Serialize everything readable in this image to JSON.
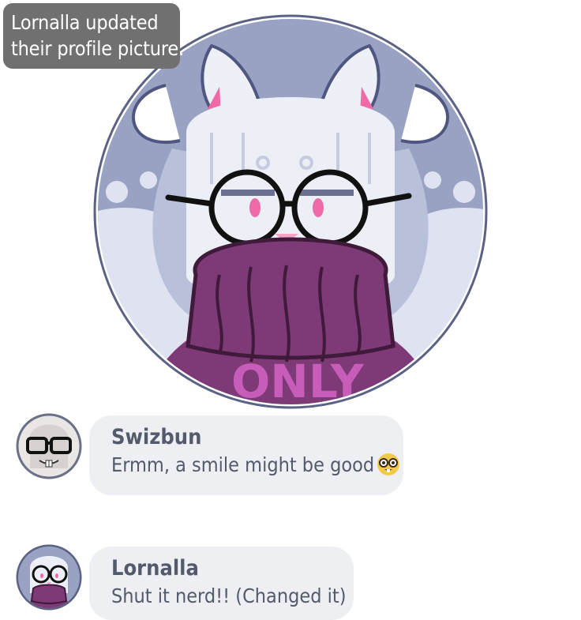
{
  "notification": {
    "line1": "Lornalla updated",
    "line2": "their profile picture."
  },
  "profile_picture": {
    "icon": "bunny-avatar-icon",
    "sweater_text": "ONLY"
  },
  "messages": [
    {
      "sender": "Swizbun",
      "text": "Ermm, a smile might be good",
      "emoji": "nerd-face-icon",
      "avatar": "swizbun-avatar-icon"
    },
    {
      "sender": "Lornalla",
      "text": "Shut it nerd!! (Changed it)",
      "avatar": "lornalla-avatar-icon"
    }
  ],
  "colors": {
    "notice_bg": "#707070",
    "bubble_bg": "#eeeff3",
    "text": "#535a6c",
    "sweater": "#7d3a76",
    "sky": "#9aa2c4"
  }
}
